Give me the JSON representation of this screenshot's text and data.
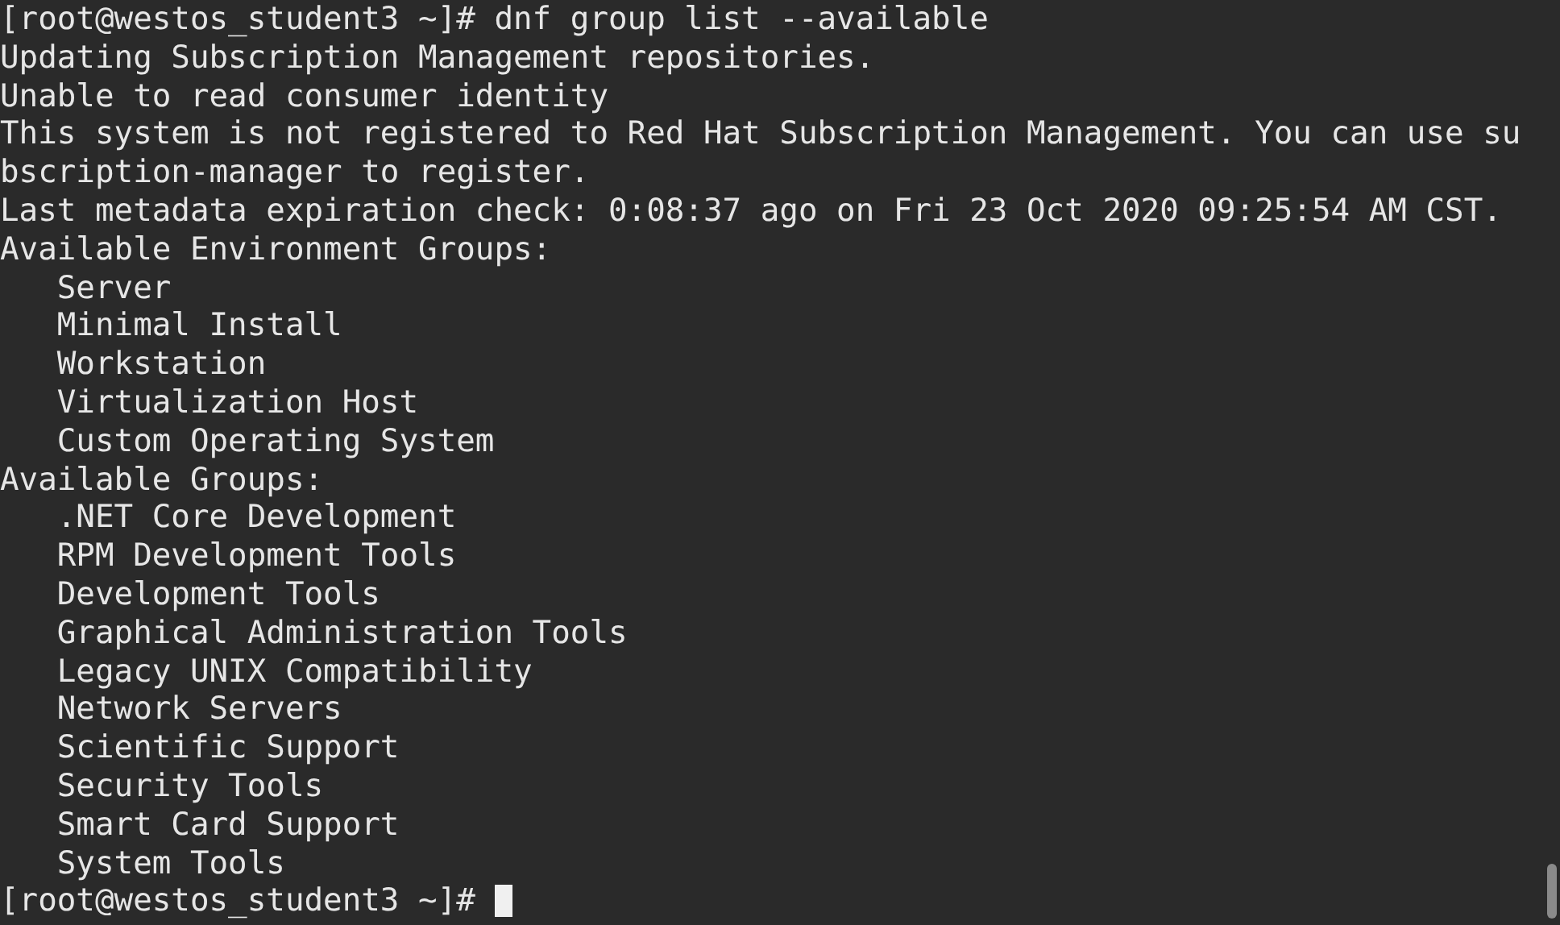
{
  "terminal": {
    "lines": [
      {
        "kind": "prompt",
        "text": "[root@westos_student3 ~]# dnf group list --available",
        "cursor": false
      },
      {
        "kind": "output",
        "text": "Updating Subscription Management repositories."
      },
      {
        "kind": "output",
        "text": "Unable to read consumer identity"
      },
      {
        "kind": "output",
        "text": "This system is not registered to Red Hat Subscription Management. You can use su"
      },
      {
        "kind": "output",
        "text": "bscription-manager to register."
      },
      {
        "kind": "output",
        "text": "Last metadata expiration check: 0:08:37 ago on Fri 23 Oct 2020 09:25:54 AM CST."
      },
      {
        "kind": "output",
        "text": "Available Environment Groups:"
      },
      {
        "kind": "output",
        "text": "   Server"
      },
      {
        "kind": "output",
        "text": "   Minimal Install"
      },
      {
        "kind": "output",
        "text": "   Workstation"
      },
      {
        "kind": "output",
        "text": "   Virtualization Host"
      },
      {
        "kind": "output",
        "text": "   Custom Operating System"
      },
      {
        "kind": "output",
        "text": "Available Groups:"
      },
      {
        "kind": "output",
        "text": "   .NET Core Development"
      },
      {
        "kind": "output",
        "text": "   RPM Development Tools"
      },
      {
        "kind": "output",
        "text": "   Development Tools"
      },
      {
        "kind": "output",
        "text": "   Graphical Administration Tools"
      },
      {
        "kind": "output",
        "text": "   Legacy UNIX Compatibility"
      },
      {
        "kind": "output",
        "text": "   Network Servers"
      },
      {
        "kind": "output",
        "text": "   Scientific Support"
      },
      {
        "kind": "output",
        "text": "   Security Tools"
      },
      {
        "kind": "output",
        "text": "   Smart Card Support"
      },
      {
        "kind": "output",
        "text": "   System Tools"
      },
      {
        "kind": "prompt",
        "text": "[root@westos_student3 ~]# ",
        "cursor": true
      }
    ]
  }
}
